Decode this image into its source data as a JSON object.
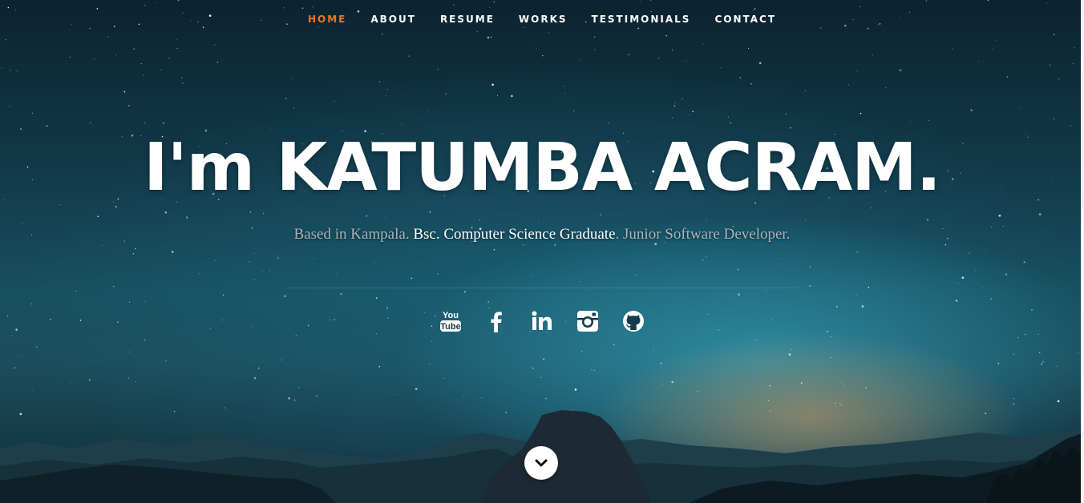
{
  "nav": {
    "items": [
      {
        "label": "Home",
        "active": true
      },
      {
        "label": "About",
        "active": false
      },
      {
        "label": "Resume",
        "active": false
      },
      {
        "label": "Works",
        "active": false
      },
      {
        "label": "Testimonials",
        "active": false
      },
      {
        "label": "Contact",
        "active": false
      }
    ]
  },
  "hero": {
    "heading": "I'm KATUMBA ACRAM.",
    "intro": {
      "part1": "Based in Kampala. ",
      "highlight": "Bsc. Computer Science Graduate",
      "part2": ". Junior Software Developer."
    }
  },
  "social": [
    {
      "name": "youtube",
      "icon": "youtube-icon"
    },
    {
      "name": "facebook",
      "icon": "facebook-icon"
    },
    {
      "name": "linkedin",
      "icon": "linkedin-icon"
    },
    {
      "name": "instagram",
      "icon": "instagram-icon"
    },
    {
      "name": "github",
      "icon": "github-icon"
    }
  ],
  "scroll": {
    "icon": "chevron-down-icon"
  },
  "colors": {
    "accent": "#e8782a",
    "text": "#ffffff",
    "muted": "#a9b6bb"
  }
}
